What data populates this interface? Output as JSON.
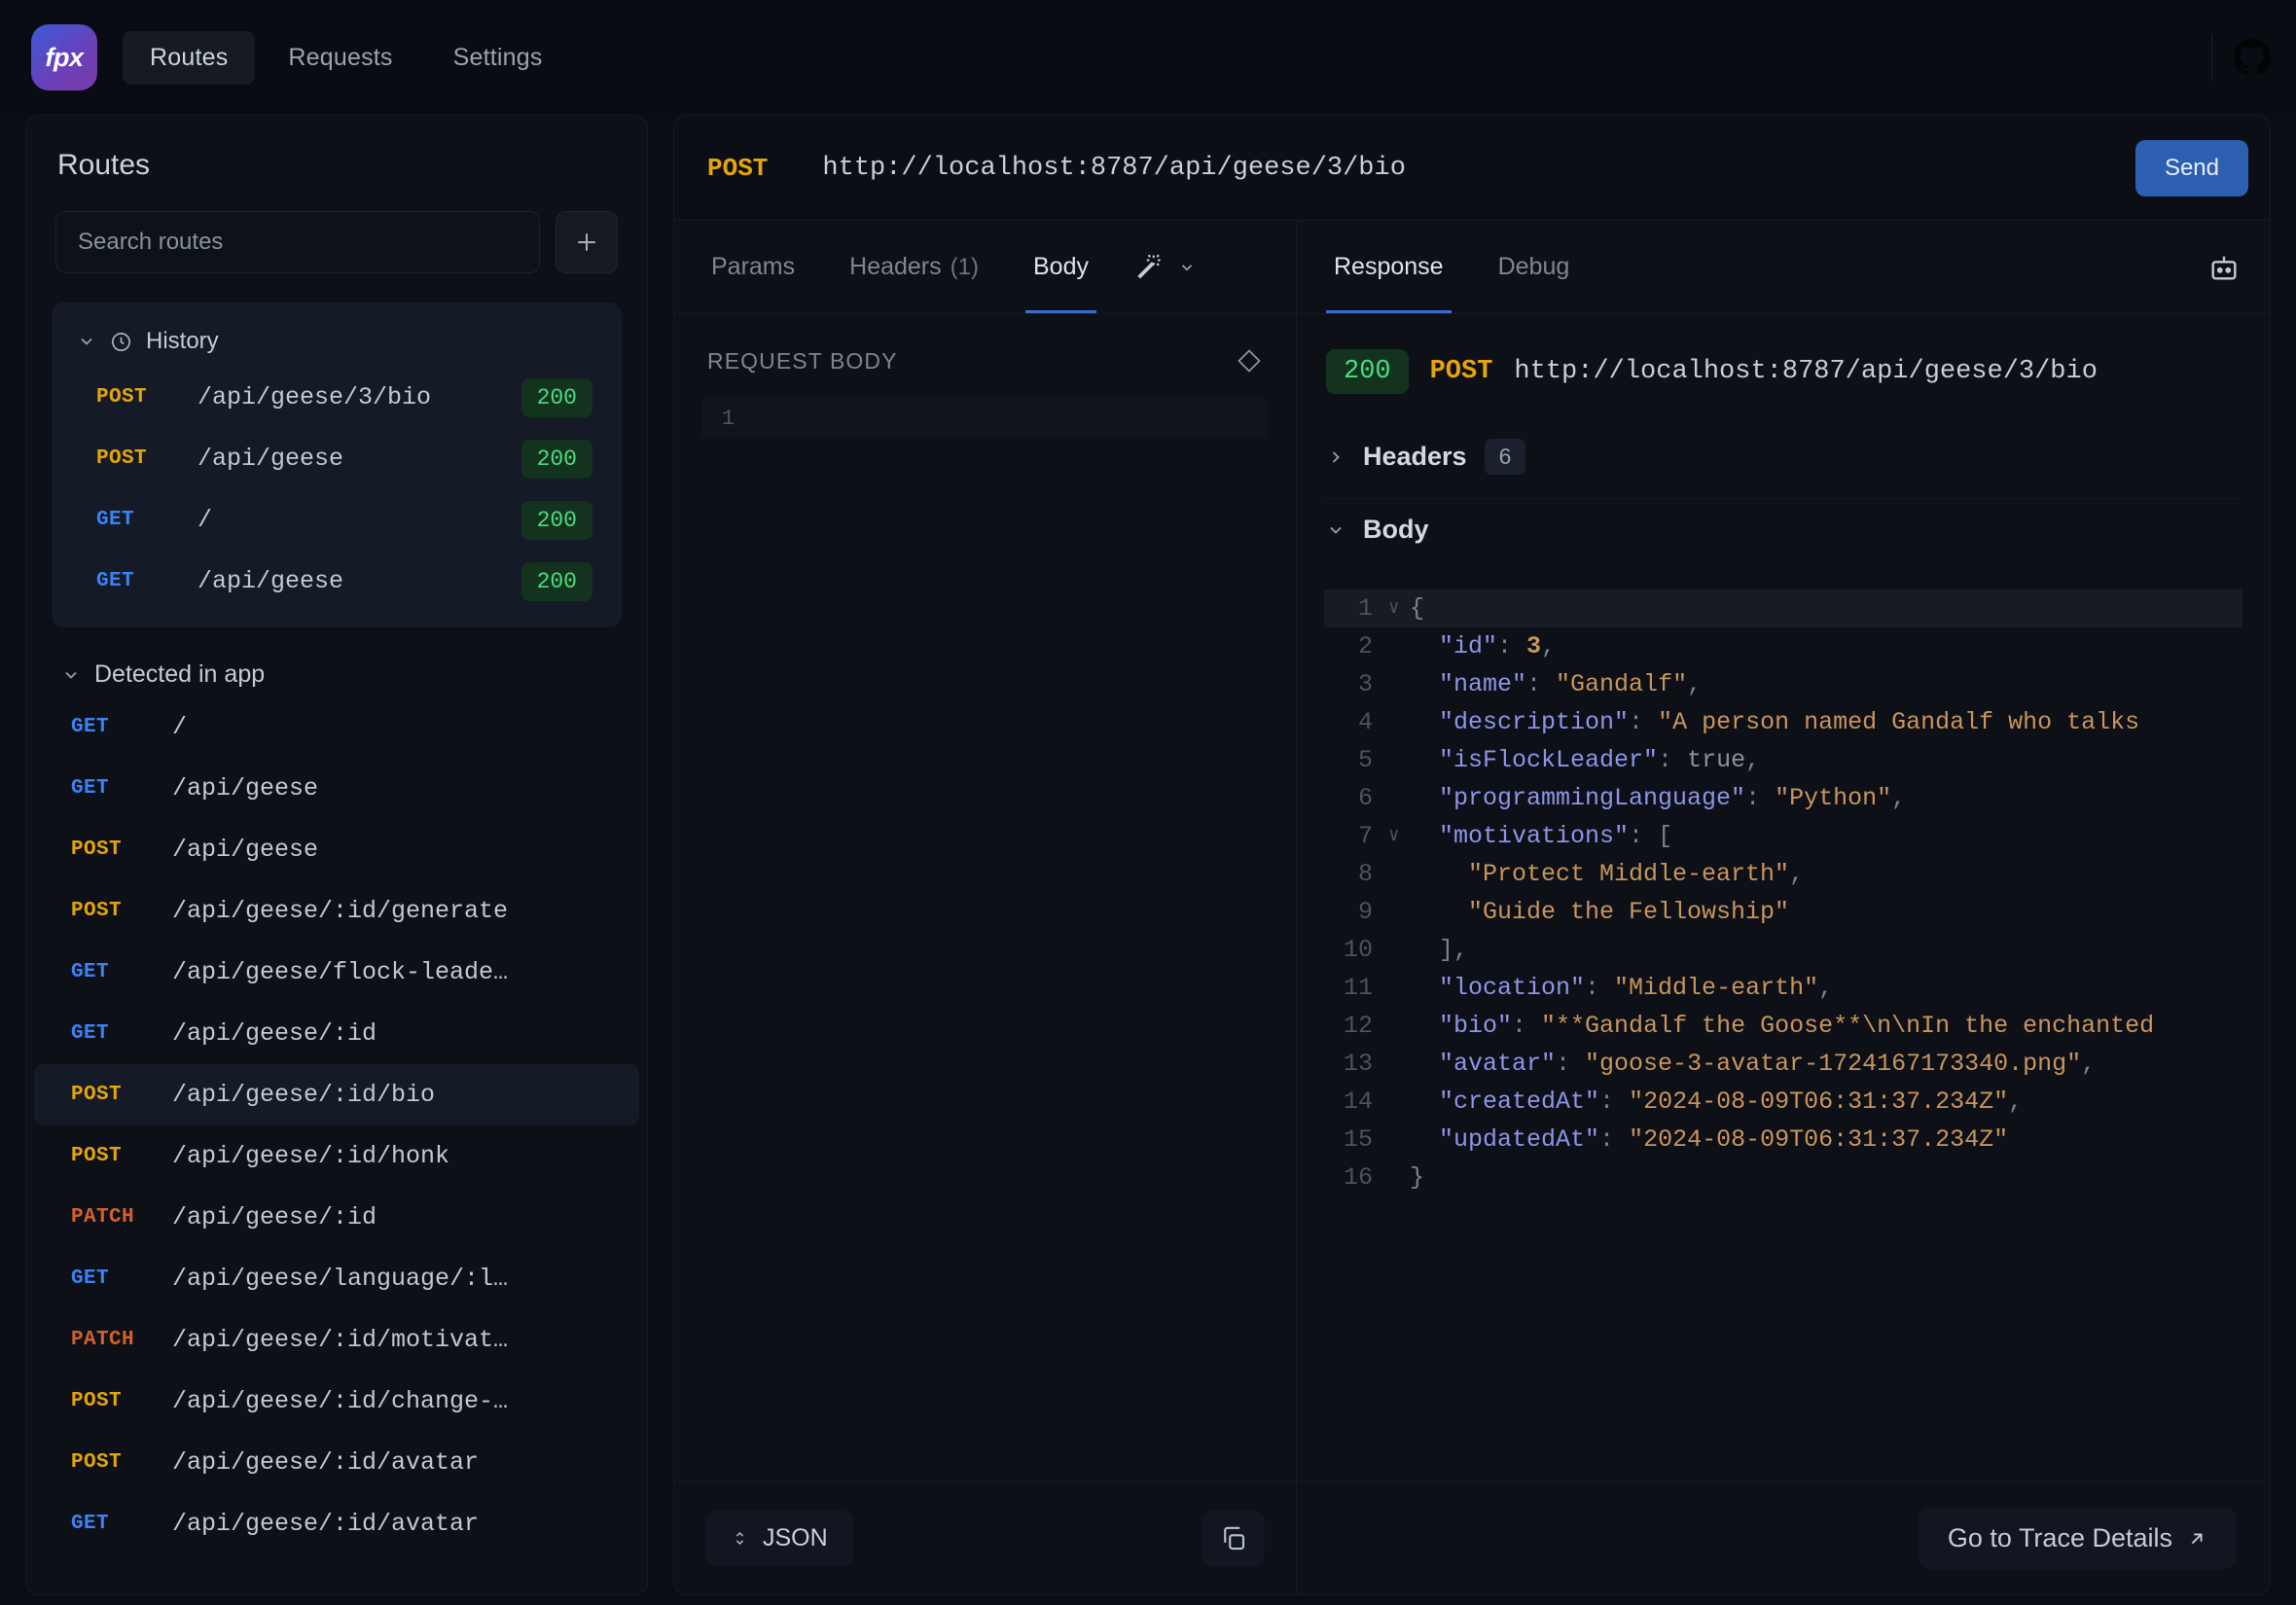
{
  "app": {
    "logo_text": "fpx",
    "nav_tabs": [
      {
        "label": "Routes",
        "active": true
      },
      {
        "label": "Requests",
        "active": false
      },
      {
        "label": "Settings",
        "active": false
      }
    ],
    "github_icon": "github-icon"
  },
  "sidebar": {
    "title": "Routes",
    "search_placeholder": "Search routes",
    "search_value": "",
    "add_button_label": "+",
    "history": {
      "label": "History",
      "icon": "clock-icon",
      "items": [
        {
          "method": "POST",
          "path": "/api/geese/3/bio",
          "status": "200"
        },
        {
          "method": "POST",
          "path": "/api/geese",
          "status": "200"
        },
        {
          "method": "GET",
          "path": "/",
          "status": "200"
        },
        {
          "method": "GET",
          "path": "/api/geese",
          "status": "200"
        }
      ]
    },
    "detected": {
      "label": "Detected in app",
      "items": [
        {
          "method": "GET",
          "path": "/",
          "selected": false
        },
        {
          "method": "GET",
          "path": "/api/geese",
          "selected": false
        },
        {
          "method": "POST",
          "path": "/api/geese",
          "selected": false
        },
        {
          "method": "POST",
          "path": "/api/geese/:id/generate",
          "selected": false
        },
        {
          "method": "GET",
          "path": "/api/geese/flock-leade…",
          "selected": false
        },
        {
          "method": "GET",
          "path": "/api/geese/:id",
          "selected": false
        },
        {
          "method": "POST",
          "path": "/api/geese/:id/bio",
          "selected": true
        },
        {
          "method": "POST",
          "path": "/api/geese/:id/honk",
          "selected": false
        },
        {
          "method": "PATCH",
          "path": "/api/geese/:id",
          "selected": false
        },
        {
          "method": "GET",
          "path": "/api/geese/language/:l…",
          "selected": false
        },
        {
          "method": "PATCH",
          "path": "/api/geese/:id/motivat…",
          "selected": false
        },
        {
          "method": "POST",
          "path": "/api/geese/:id/change-…",
          "selected": false
        },
        {
          "method": "POST",
          "path": "/api/geese/:id/avatar",
          "selected": false
        },
        {
          "method": "GET",
          "path": "/api/geese/:id/avatar",
          "selected": false
        }
      ]
    }
  },
  "request": {
    "method": "POST",
    "url": "http://localhost:8787/api/geese/3/bio",
    "send_label": "Send",
    "tabs": [
      {
        "label": "Params",
        "count": "",
        "active": false
      },
      {
        "label": "Headers",
        "count": "(1)",
        "active": false
      },
      {
        "label": "Body",
        "count": "",
        "active": true
      }
    ],
    "magic_icon": "wand-sparkles-icon",
    "body_panel_label": "REQUEST BODY",
    "body_panel_icon": "diamond-icon",
    "body_line_number": "1",
    "body_value": "",
    "footer": {
      "format_label": "JSON",
      "format_icon": "chevron-up-down-icon",
      "copy_icon": "copy-icon"
    }
  },
  "response": {
    "tabs": [
      {
        "label": "Response",
        "active": true
      },
      {
        "label": "Debug",
        "active": false
      }
    ],
    "bot_icon": "bot-icon",
    "status": "200",
    "method": "POST",
    "url": "http://localhost:8787/api/geese/3/bio",
    "headers_section": {
      "label": "Headers",
      "count": "6",
      "expanded": false
    },
    "body_section": {
      "label": "Body",
      "expanded": true
    },
    "trace_label": "Go to Trace Details",
    "trace_icon": "arrow-up-right-icon",
    "body_lines": [
      {
        "n": "1",
        "fold": "∨",
        "hl": true,
        "parts": [
          {
            "t": "{",
            "c": "p"
          }
        ]
      },
      {
        "n": "2",
        "fold": "",
        "hl": false,
        "parts": [
          {
            "t": "  \"id\"",
            "c": "k"
          },
          {
            "t": ": ",
            "c": "p"
          },
          {
            "t": "3",
            "c": "n"
          },
          {
            "t": ",",
            "c": "p"
          }
        ]
      },
      {
        "n": "3",
        "fold": "",
        "hl": false,
        "parts": [
          {
            "t": "  \"name\"",
            "c": "k"
          },
          {
            "t": ": ",
            "c": "p"
          },
          {
            "t": "\"Gandalf\"",
            "c": "s"
          },
          {
            "t": ",",
            "c": "p"
          }
        ]
      },
      {
        "n": "4",
        "fold": "",
        "hl": false,
        "parts": [
          {
            "t": "  \"description\"",
            "c": "k"
          },
          {
            "t": ": ",
            "c": "p"
          },
          {
            "t": "\"A person named Gandalf who talks  ",
            "c": "s"
          }
        ]
      },
      {
        "n": "5",
        "fold": "",
        "hl": false,
        "parts": [
          {
            "t": "  \"isFlockLeader\"",
            "c": "k"
          },
          {
            "t": ": ",
            "c": "p"
          },
          {
            "t": "true",
            "c": "b"
          },
          {
            "t": ",",
            "c": "p"
          }
        ]
      },
      {
        "n": "6",
        "fold": "",
        "hl": false,
        "parts": [
          {
            "t": "  \"programmingLanguage\"",
            "c": "k"
          },
          {
            "t": ": ",
            "c": "p"
          },
          {
            "t": "\"Python\"",
            "c": "s"
          },
          {
            "t": ",",
            "c": "p"
          }
        ]
      },
      {
        "n": "7",
        "fold": "∨",
        "hl": false,
        "parts": [
          {
            "t": "  \"motivations\"",
            "c": "k"
          },
          {
            "t": ": ",
            "c": "p"
          },
          {
            "t": "[",
            "c": "p"
          }
        ]
      },
      {
        "n": "8",
        "fold": "",
        "hl": false,
        "parts": [
          {
            "t": "    \"Protect Middle-earth\"",
            "c": "s"
          },
          {
            "t": ",",
            "c": "p"
          }
        ]
      },
      {
        "n": "9",
        "fold": "",
        "hl": false,
        "parts": [
          {
            "t": "    \"Guide the Fellowship\"",
            "c": "s"
          }
        ]
      },
      {
        "n": "10",
        "fold": "",
        "hl": false,
        "parts": [
          {
            "t": "  ],",
            "c": "p"
          }
        ]
      },
      {
        "n": "11",
        "fold": "",
        "hl": false,
        "parts": [
          {
            "t": "  \"location\"",
            "c": "k"
          },
          {
            "t": ": ",
            "c": "p"
          },
          {
            "t": "\"Middle-earth\"",
            "c": "s"
          },
          {
            "t": ",",
            "c": "p"
          }
        ]
      },
      {
        "n": "12",
        "fold": "",
        "hl": false,
        "parts": [
          {
            "t": "  \"bio\"",
            "c": "k"
          },
          {
            "t": ": ",
            "c": "p"
          },
          {
            "t": "\"**Gandalf the Goose**\\n\\nIn the enchanted",
            "c": "s"
          }
        ]
      },
      {
        "n": "13",
        "fold": "",
        "hl": false,
        "parts": [
          {
            "t": "  \"avatar\"",
            "c": "k"
          },
          {
            "t": ": ",
            "c": "p"
          },
          {
            "t": "\"goose-3-avatar-1724167173340.png\"",
            "c": "s"
          },
          {
            "t": ",",
            "c": "p"
          }
        ]
      },
      {
        "n": "14",
        "fold": "",
        "hl": false,
        "parts": [
          {
            "t": "  \"createdAt\"",
            "c": "k"
          },
          {
            "t": ": ",
            "c": "p"
          },
          {
            "t": "\"2024-08-09T06:31:37.234Z\"",
            "c": "s"
          },
          {
            "t": ",",
            "c": "p"
          }
        ]
      },
      {
        "n": "15",
        "fold": "",
        "hl": false,
        "parts": [
          {
            "t": "  \"updatedAt\"",
            "c": "k"
          },
          {
            "t": ": ",
            "c": "p"
          },
          {
            "t": "\"2024-08-09T06:31:37.234Z\"",
            "c": "s"
          }
        ]
      },
      {
        "n": "16",
        "fold": "",
        "hl": false,
        "parts": [
          {
            "t": "}",
            "c": "p"
          }
        ]
      }
    ]
  },
  "colors": {
    "accent_blue": "#2d5fb0",
    "method_get": "#3b82f6",
    "method_post": "#e5a50a",
    "method_patch": "#d4602a",
    "status_ok": "#4ade80"
  }
}
